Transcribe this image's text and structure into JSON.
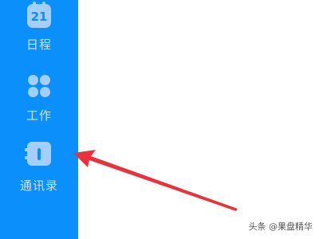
{
  "sidebar": {
    "items": [
      {
        "label": "日程",
        "icon": "calendar-icon",
        "icon_text": "21"
      },
      {
        "label": "工作",
        "icon": "workbench-grid-icon"
      },
      {
        "label": "通讯录",
        "icon": "contacts-book-icon"
      }
    ]
  },
  "watermark": "头条 @果盘精华",
  "colors": {
    "sidebar_bg": "#0b90fb",
    "icon_fill": "#a4cffd",
    "label_text": "#c9e3fd",
    "arrow": "#e8323c",
    "content_bg": "#ffffff"
  }
}
